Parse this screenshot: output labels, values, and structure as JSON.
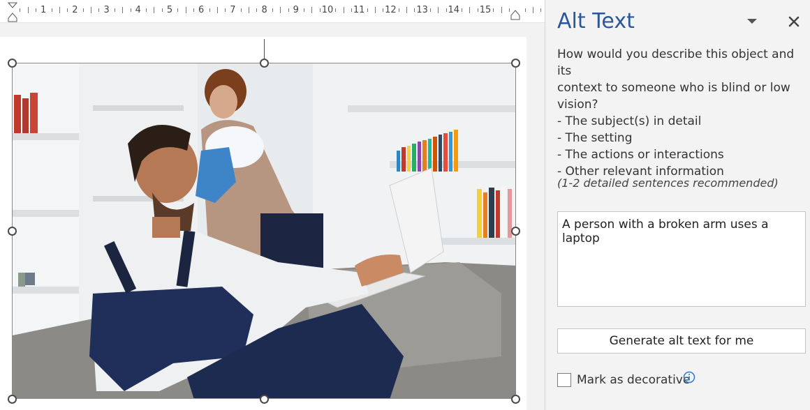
{
  "ruler": {
    "numbers": [
      "1",
      "2",
      "3",
      "4",
      "5",
      "6",
      "7",
      "8",
      "9",
      "10",
      "11",
      "12",
      "13",
      "14",
      "15"
    ]
  },
  "pane": {
    "title": "Alt Text",
    "description_lines": [
      "How would you describe this object and its",
      "context to someone who is blind or low",
      "vision?",
      "- The subject(s) in detail",
      "- The setting",
      "- The actions or interactions",
      "- Other relevant information"
    ],
    "hint": "(1-2 detailed sentences recommended)",
    "alt_text_value": "A person with a broken arm uses a laptop",
    "generate_button_label": "Generate alt text for me",
    "decorative_label": "Mark as decorative",
    "decorative_checked": false
  },
  "icons": {
    "menu": "chevron-down-icon",
    "close": "close-icon",
    "info": "info-icon"
  },
  "colors": {
    "title": "#2b579a",
    "info": "#2b79d4",
    "pane_bg": "#f3f3f3"
  }
}
